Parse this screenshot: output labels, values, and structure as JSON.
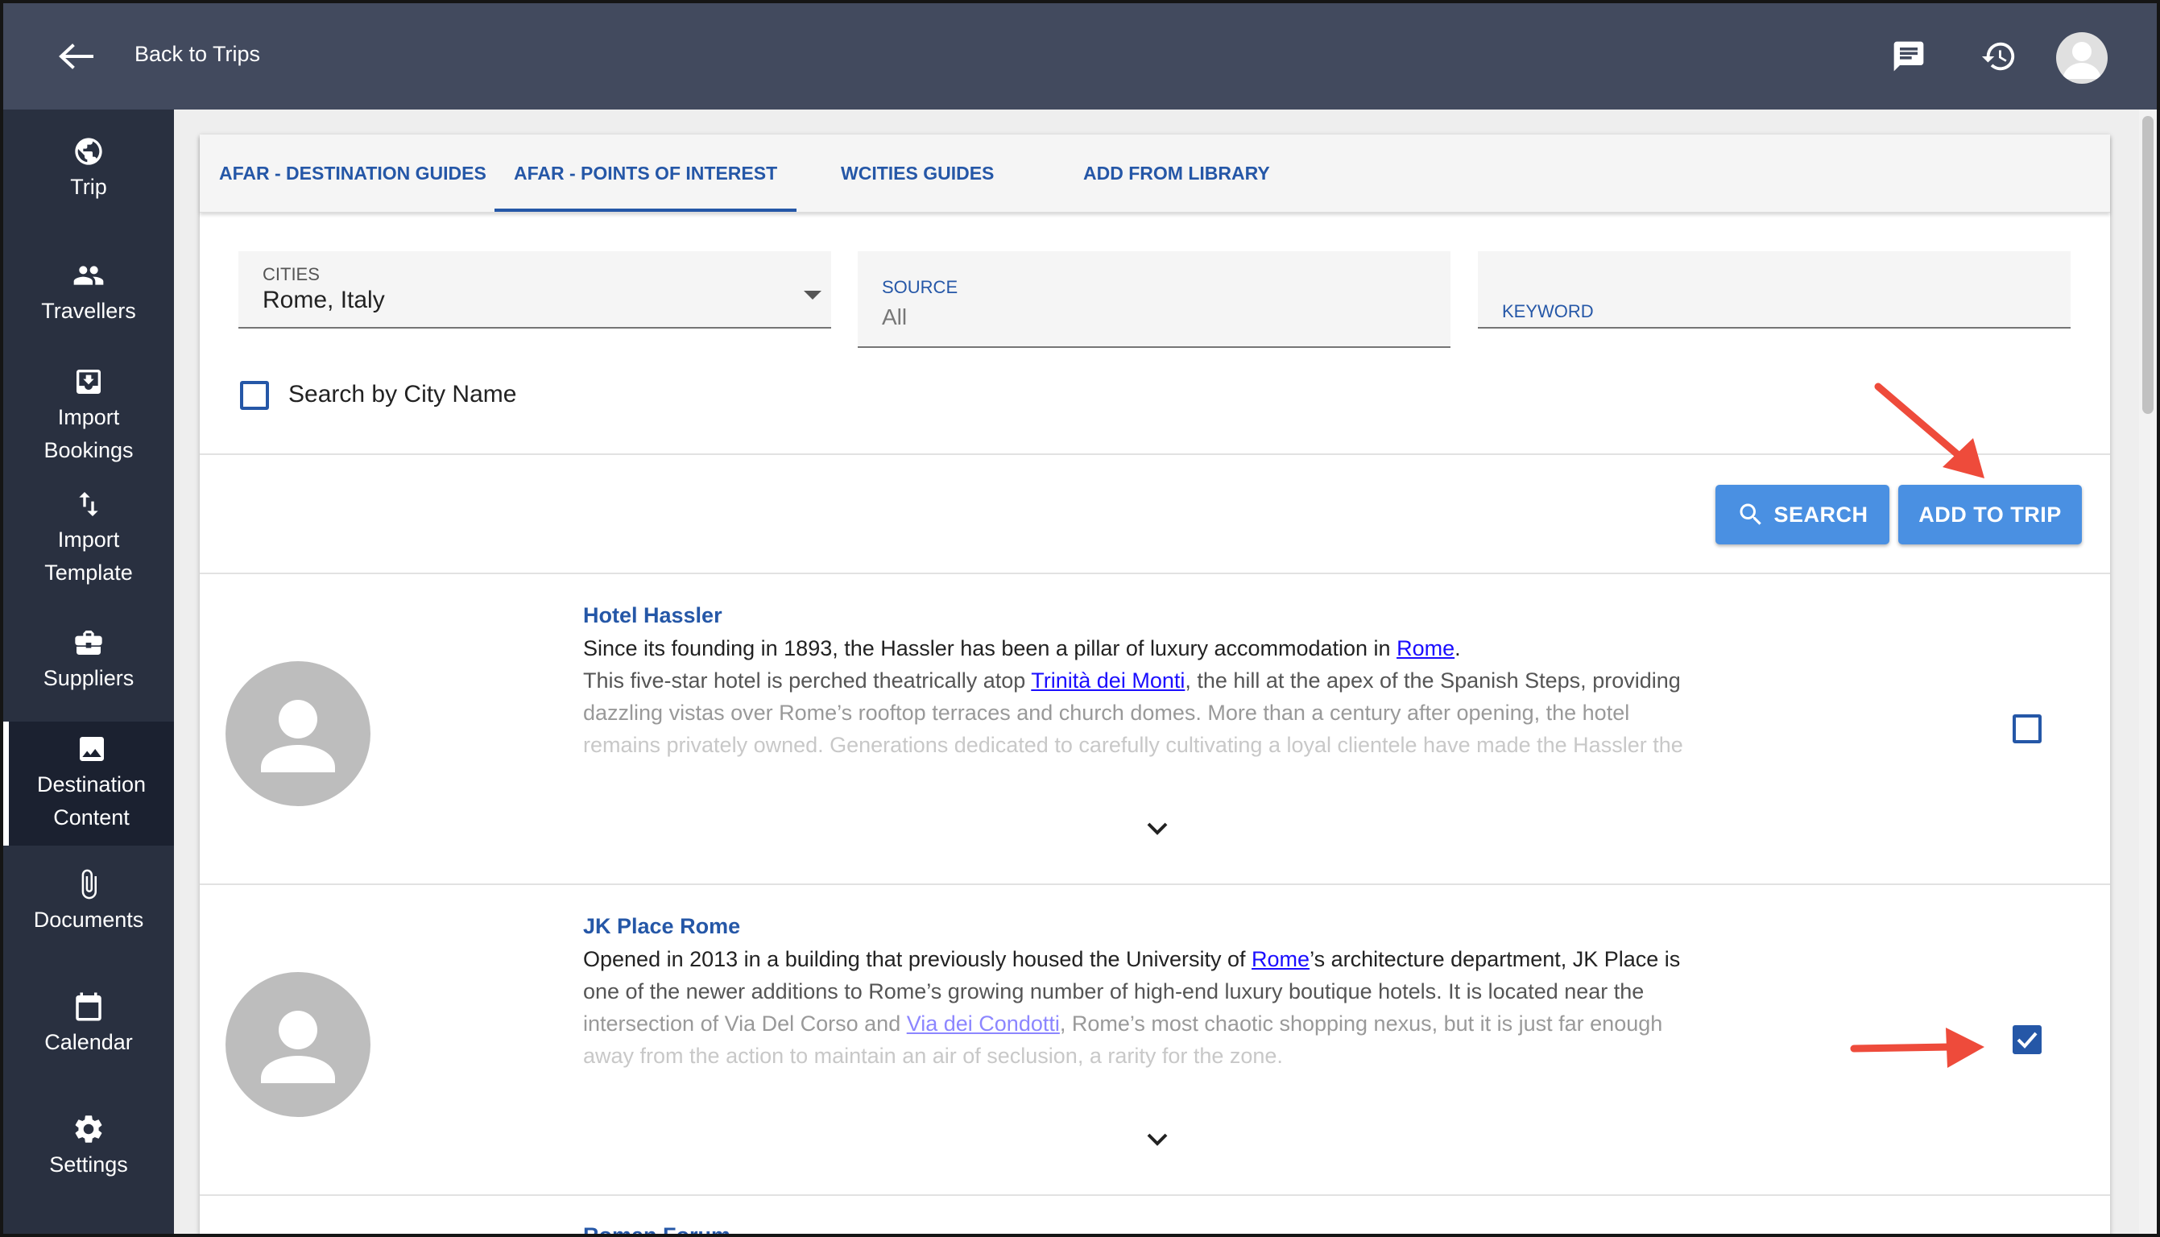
{
  "header": {
    "back_label": "Back to Trips",
    "icons": [
      "arrow-left-icon",
      "chat-icon",
      "history-icon",
      "account-avatar"
    ]
  },
  "sidebar": {
    "items": [
      {
        "label": "Trip",
        "icon": "globe-icon"
      },
      {
        "label": "Travellers",
        "icon": "people-icon"
      },
      {
        "label": "Import\nBookings",
        "icon": "import-icon"
      },
      {
        "label": "Import\nTemplate",
        "icon": "swap-vertical-icon"
      },
      {
        "label": "Suppliers",
        "icon": "briefcase-icon"
      },
      {
        "label": "Destination\nContent",
        "icon": "image-icon",
        "active": true
      },
      {
        "label": "Documents",
        "icon": "paperclip-icon"
      },
      {
        "label": "Calendar",
        "icon": "calendar-icon"
      },
      {
        "label": "Settings",
        "icon": "gear-icon"
      }
    ]
  },
  "tabs": [
    {
      "label": "AFAR - DESTINATION GUIDES",
      "active": false
    },
    {
      "label": "AFAR - POINTS OF INTEREST",
      "active": true
    },
    {
      "label": "WCITIES GUIDES",
      "active": false
    },
    {
      "label": "ADD FROM LIBRARY",
      "active": false
    }
  ],
  "filters": {
    "cities": {
      "label": "CITIES",
      "value": "Rome, Italy"
    },
    "source": {
      "label": "SOURCE",
      "value": "All"
    },
    "keyword": {
      "label": "KEYWORD",
      "value": ""
    },
    "search_by_city": {
      "label": "Search by City Name",
      "checked": false
    }
  },
  "actions": {
    "search_label": "SEARCH",
    "add_label": "ADD TO TRIP"
  },
  "results": [
    {
      "title": "Hotel Hassler",
      "lines": [
        [
          "Since its founding in 1893, the Hassler has been a pillar of luxury accommodation in ",
          "Rome",
          "."
        ],
        [
          "This five-star hotel is perched theatrically atop ",
          "Trinità dei Monti",
          ", the hill at the apex of the Spanish Steps, providing"
        ],
        [
          "dazzling vistas over Rome’s rooftop terraces and church domes. More than a century after opening, the hotel"
        ],
        [
          "remains privately owned. Generations dedicated to carefully cultivating a loyal clientele have made the Hassler the"
        ]
      ],
      "selected": false
    },
    {
      "title": "JK Place Rome",
      "lines": [
        [
          "Opened in 2013 in a building that previously housed the University of ",
          "Rome",
          "’s architecture department, JK Place is"
        ],
        [
          "one of the newer additions to Rome’s growing number of high-end luxury boutique hotels. It is located near the"
        ],
        [
          "intersection of Via Del Corso and ",
          "Via dei Condotti",
          ", Rome’s most chaotic shopping nexus, but it is just far enough"
        ],
        [
          "away from the action to maintain an air of seclusion, a rarity for the zone."
        ]
      ],
      "selected": true
    },
    {
      "title": "Roman Forum"
    }
  ],
  "colors": {
    "topbar": "#424a5e",
    "sidebar": "#293040",
    "accent": "#2557a7",
    "button": "#4a90e2",
    "annotation_arrow": "#ee4b3b"
  }
}
